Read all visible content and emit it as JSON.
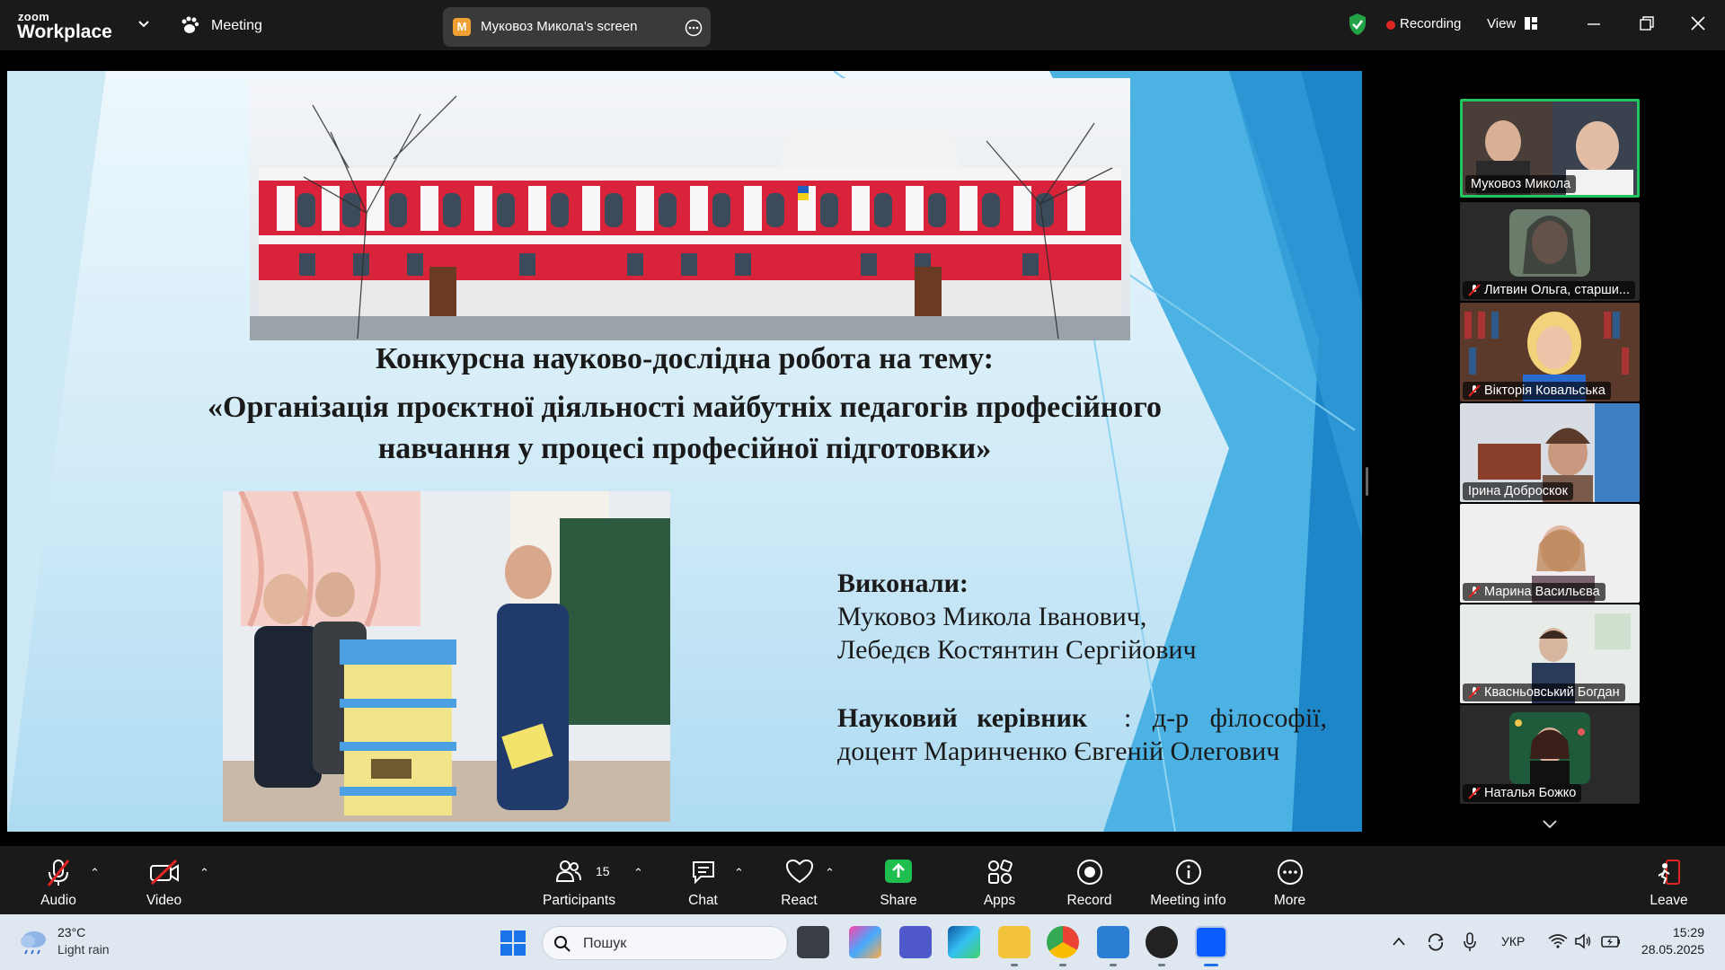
{
  "topbar": {
    "brand_small": "zoom",
    "brand_big": "Workplace",
    "meeting_label": "Meeting",
    "share_avatar": "M",
    "share_title": "Муковоз Микола's screen",
    "recording_label": "Recording",
    "view_label": "View"
  },
  "slide": {
    "title_line1": "Конкурсна науково-дослідна робота на тему:",
    "title_line2": "«Організація проєктної діяльності майбутніх педагогів професійного",
    "title_line3": "навчання у процесі професійної підготовки»",
    "authors_heading": "Виконали:",
    "author1": "Муковоз Микола Іванович,",
    "author2": "Лебедєв Костянтин Сергійович",
    "supervisor_heading": "Науковий керівник",
    "supervisor_title": ": д-р філософії,",
    "supervisor_name": "доцент Маринченко Євгеній Олегович"
  },
  "participants": [
    {
      "name": "Муковоз Микола",
      "muted": false,
      "active": true
    },
    {
      "name": "Литвин Ольга, старши...",
      "muted": true,
      "active": false
    },
    {
      "name": "Вікторія Ковальська",
      "muted": true,
      "active": false
    },
    {
      "name": "Ірина Доброскок",
      "muted": false,
      "active": false
    },
    {
      "name": "Марина Васильєва",
      "muted": true,
      "active": false
    },
    {
      "name": "Квасньовський Богдан",
      "muted": true,
      "active": false
    },
    {
      "name": "Наталья Божко",
      "muted": true,
      "active": false
    }
  ],
  "toolbar": {
    "audio": "Audio",
    "video": "Video",
    "participants": "Participants",
    "participants_count": "15",
    "chat": "Chat",
    "react": "React",
    "share": "Share",
    "apps": "Apps",
    "record": "Record",
    "meeting_info": "Meeting info",
    "more": "More",
    "leave": "Leave"
  },
  "taskbar": {
    "weather_temp": "23°C",
    "weather_desc": "Light rain",
    "search_placeholder": "Пошук",
    "language": "УКР",
    "time": "15:29",
    "date": "28.05.2025"
  },
  "colors": {
    "active_border": "#22c55e",
    "recording_dot": "#e02424",
    "share_green": "#1fbf4f",
    "muted_red": "#e02424"
  }
}
